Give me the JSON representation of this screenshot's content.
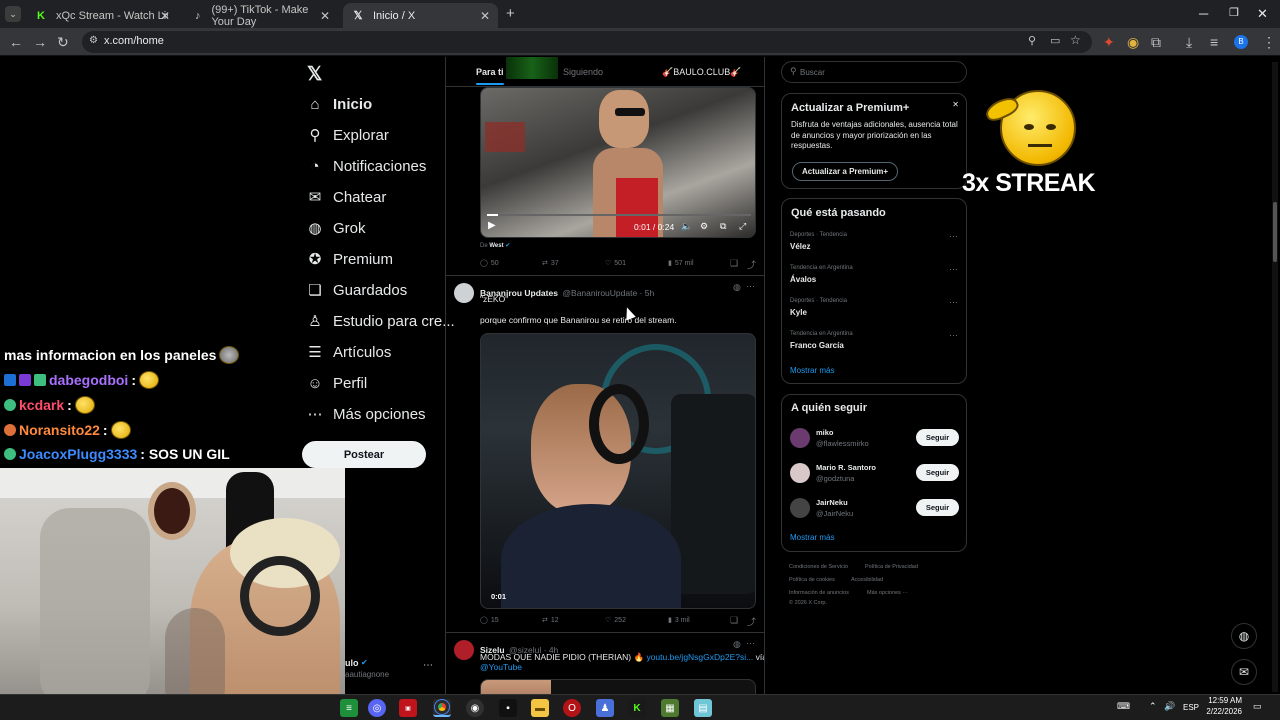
{
  "browser": {
    "tabs": [
      {
        "title": "xQc Stream - Watch Live on Kic",
        "favicon": "kick-icon",
        "color": "#53fc18"
      },
      {
        "title": "(99+) TikTok - Make Your Day",
        "favicon": "tiktok-icon",
        "color": "#ffffff"
      },
      {
        "title": "Inicio / X",
        "favicon": "x-logo-icon",
        "color": "#ffffff",
        "active": true
      }
    ],
    "url": "x.com/home",
    "new_tab": "+",
    "profile_initial": "B"
  },
  "nav": {
    "items": [
      {
        "label": "Inicio",
        "icon": "home-icon",
        "glyph": "⌂"
      },
      {
        "label": "Explorar",
        "icon": "search-icon",
        "glyph": "⚲"
      },
      {
        "label": "Notificaciones",
        "icon": "bell-icon",
        "glyph": "♫"
      },
      {
        "label": "Chatear",
        "icon": "mail-icon",
        "glyph": "✉"
      },
      {
        "label": "Grok",
        "icon": "grok-icon",
        "glyph": "◍"
      },
      {
        "label": "Premium",
        "icon": "verified-icon",
        "glyph": "✪"
      },
      {
        "label": "Guardados",
        "icon": "bookmark-icon",
        "glyph": "❏"
      },
      {
        "label": "Estudio para cre...",
        "icon": "creator-studio-icon",
        "glyph": "♙"
      },
      {
        "label": "Artículos",
        "icon": "articles-icon",
        "glyph": "☰"
      },
      {
        "label": "Perfil",
        "icon": "person-icon",
        "glyph": "☺"
      },
      {
        "label": "Más opciones",
        "icon": "more-icon",
        "glyph": "⋯"
      }
    ],
    "post_button": "Postear",
    "account_name": "ulo",
    "account_handle": "aautiagnone"
  },
  "timeline": {
    "tabs": [
      "Para ti",
      "Siguiendo",
      "🎸BAULO.CLUB🎸"
    ],
    "tweet1": {
      "video_time": "0:01 / 0:24",
      "from_label": "De",
      "from_name": "West",
      "replies": "50",
      "retweets": "37",
      "likes": "501",
      "views": "57 mil"
    },
    "tweet2": {
      "name": "Bananirou Updates",
      "handle": "@BananirouUpdate · 5h",
      "quote": "\"zEKO\"",
      "text": "porque confirmo que Bananirou se retiro del stream.",
      "video_time": "0:01",
      "replies": "15",
      "retweets": "12",
      "likes": "252",
      "views": "3 mil"
    },
    "tweet3": {
      "name": "Sizelu",
      "handle": "@sizelul · 4h",
      "text": "MODAS QUE NADIE PIDIO (THERIAN) 🔥",
      "link": "youtu.be/jgNsgGxDp2E?si...",
      "via": "vía",
      "mention": "@YouTube"
    }
  },
  "sidebar": {
    "search_placeholder": "Buscar",
    "premium": {
      "title": "Actualizar a Premium+",
      "body": "Disfruta de ventajas adicionales, ausencia total de anuncios y mayor priorización en las respuestas.",
      "button": "Actualizar a Premium+"
    },
    "trends": {
      "title": "Qué está pasando",
      "items": [
        {
          "category": "Deportes · Tendencia",
          "name": "Vélez"
        },
        {
          "category": "Tendencia en Argentina",
          "name": "Ávalos"
        },
        {
          "category": "Deportes · Tendencia",
          "name": "Kyle"
        },
        {
          "category": "Tendencia en Argentina",
          "name": "Franco García"
        }
      ],
      "show_more": "Mostrar más"
    },
    "follow": {
      "title": "A quién seguir",
      "items": [
        {
          "name": "miko",
          "handle": "@flawlessmirko",
          "button": "Seguir",
          "color": "#6b3a6e"
        },
        {
          "name": "Mario R. Santoro",
          "handle": "@godztuna",
          "button": "Seguir",
          "color": "#d8c8c8"
        },
        {
          "name": "JairNeku",
          "handle": "@JairNeku",
          "button": "Seguir",
          "color": "#444"
        }
      ],
      "show_more": "Mostrar más"
    },
    "footer": [
      "Condiciones de Servicio",
      "Política de Privacidad",
      "Política de cookies",
      "Accesibilidad",
      "Información de anuncios",
      "Más opciones ···",
      "© 2026 X Corp."
    ]
  },
  "overlay": {
    "streak_text": "3x STREAK",
    "chat": [
      {
        "user": "",
        "message": "mas informacion en los paneles",
        "user_color": "#ffffff"
      },
      {
        "user": "dabegodboi",
        "message": ":",
        "user_color": "#a970ff"
      },
      {
        "user": "kcdark",
        "message": ":",
        "user_color": "#ff4d6d"
      },
      {
        "user": "Noransito22",
        "message": ":",
        "user_color": "#ff8a3d"
      },
      {
        "user": "JoacoxPlugg3333",
        "message": ": SOS UN GIL",
        "user_color": "#3d8bff"
      }
    ]
  },
  "taskbar": {
    "lang": "ESP",
    "time": "12:59 AM",
    "date": "2/22/2026"
  }
}
